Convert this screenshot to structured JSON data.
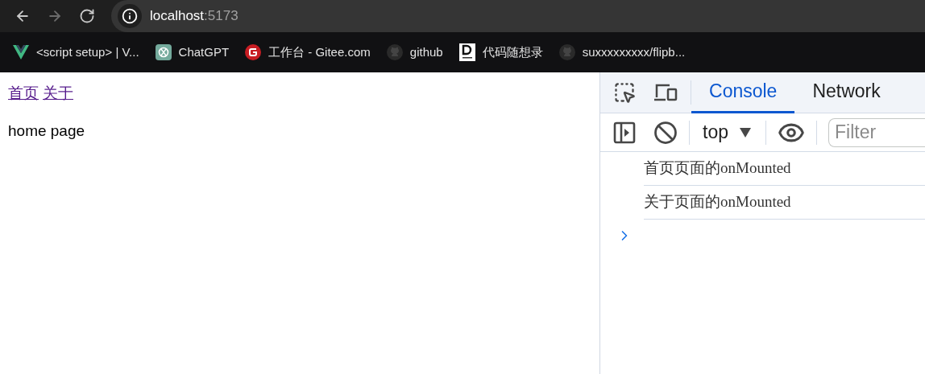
{
  "browser": {
    "nav_buttons": [
      {
        "kind": "back",
        "disabled": false
      },
      {
        "kind": "forward",
        "disabled": true
      },
      {
        "kind": "reload",
        "disabled": false
      }
    ],
    "address": {
      "host": "localhost",
      "port": ":5173"
    }
  },
  "bookmarks": [
    {
      "kind": "vue",
      "label": "<script setup> | V..."
    },
    {
      "kind": "chatgpt",
      "label": "ChatGPT"
    },
    {
      "kind": "gitee",
      "label": "工作台 - Gitee.com"
    },
    {
      "kind": "github",
      "label": "github"
    },
    {
      "kind": "d",
      "label": "代码随想录"
    },
    {
      "kind": "github",
      "label": "suxxxxxxxxx/flipb..."
    }
  ],
  "page": {
    "links": [
      "首页",
      "关于"
    ],
    "text": "home page"
  },
  "devtools": {
    "tabs": [
      {
        "label": "Console",
        "selected": true
      },
      {
        "label": "Network",
        "selected": false
      }
    ],
    "context": "top",
    "filter": {
      "placeholder": "Filter"
    },
    "messages": [
      "首页页面的onMounted",
      "关于页面的onMounted"
    ]
  }
}
